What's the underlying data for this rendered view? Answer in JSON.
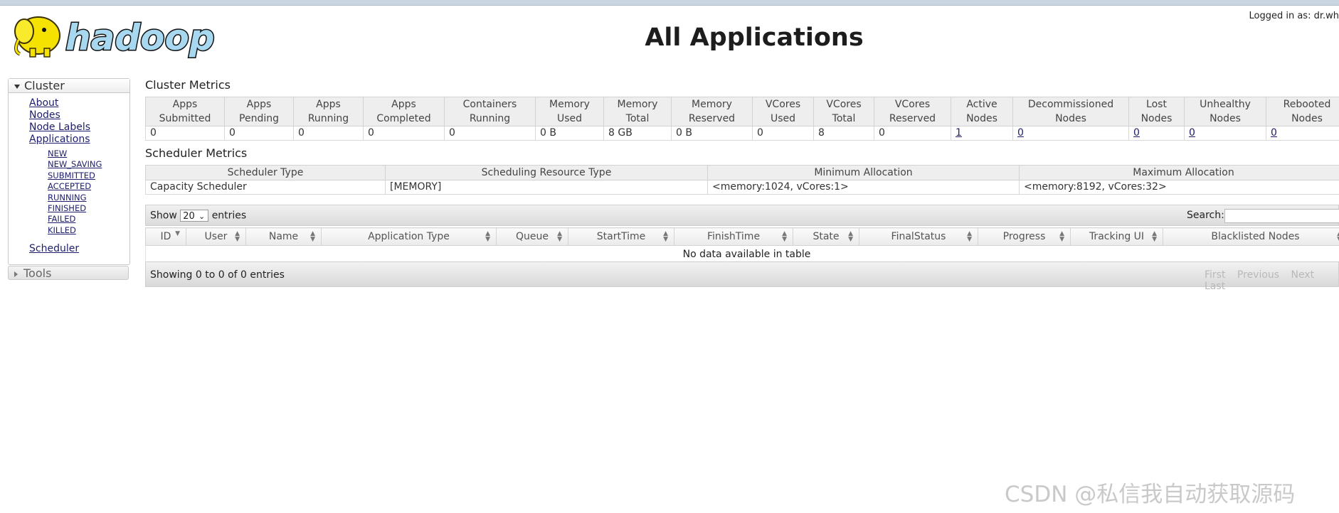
{
  "header": {
    "logo_text": "hadoop",
    "title": "All Applications",
    "logged_in": "Logged in as: dr.wh"
  },
  "sidebar": {
    "cluster_label": "Cluster",
    "links": [
      "About",
      "Nodes",
      "Node Labels",
      "Applications"
    ],
    "app_states": [
      "NEW",
      "NEW_SAVING",
      "SUBMITTED",
      "ACCEPTED",
      "RUNNING",
      "FINISHED",
      "FAILED",
      "KILLED"
    ],
    "scheduler_label": "Scheduler",
    "tools_label": "Tools"
  },
  "cluster_metrics": {
    "title": "Cluster Metrics",
    "headers": [
      [
        "Apps",
        "Submitted"
      ],
      [
        "Apps",
        "Pending"
      ],
      [
        "Apps",
        "Running"
      ],
      [
        "Apps",
        "Completed"
      ],
      [
        "Containers",
        "Running"
      ],
      [
        "Memory",
        "Used"
      ],
      [
        "Memory",
        "Total"
      ],
      [
        "Memory",
        "Reserved"
      ],
      [
        "VCores",
        "Used"
      ],
      [
        "VCores",
        "Total"
      ],
      [
        "VCores",
        "Reserved"
      ],
      [
        "Active",
        "Nodes"
      ],
      [
        "Decommissioned",
        "Nodes"
      ],
      [
        "Lost",
        "Nodes"
      ],
      [
        "Unhealthy",
        "Nodes"
      ],
      [
        "Rebooted",
        "Nodes"
      ]
    ],
    "values": [
      "0",
      "0",
      "0",
      "0",
      "0",
      "0 B",
      "8 GB",
      "0 B",
      "0",
      "8",
      "0",
      "1",
      "0",
      "0",
      "0",
      "0"
    ]
  },
  "scheduler_metrics": {
    "title": "Scheduler Metrics",
    "headers": [
      "Scheduler Type",
      "Scheduling Resource Type",
      "Minimum Allocation",
      "Maximum Allocation"
    ],
    "values": [
      "Capacity Scheduler",
      "[MEMORY]",
      "<memory:1024, vCores:1>",
      "<memory:8192, vCores:32>"
    ]
  },
  "apps_table": {
    "show_label": "Show",
    "page_size": "20",
    "entries_label": "entries",
    "search_label": "Search:",
    "columns": [
      "ID",
      "User",
      "Name",
      "Application Type",
      "Queue",
      "StartTime",
      "FinishTime",
      "State",
      "FinalStatus",
      "Progress",
      "Tracking UI",
      "Blacklisted Nodes"
    ],
    "empty_message": "No data available in table",
    "info": "Showing 0 to 0 of 0 entries",
    "pager": [
      "First",
      "Previous",
      "Next",
      "Last"
    ]
  },
  "watermark": "CSDN @私信我自动获取源码"
}
